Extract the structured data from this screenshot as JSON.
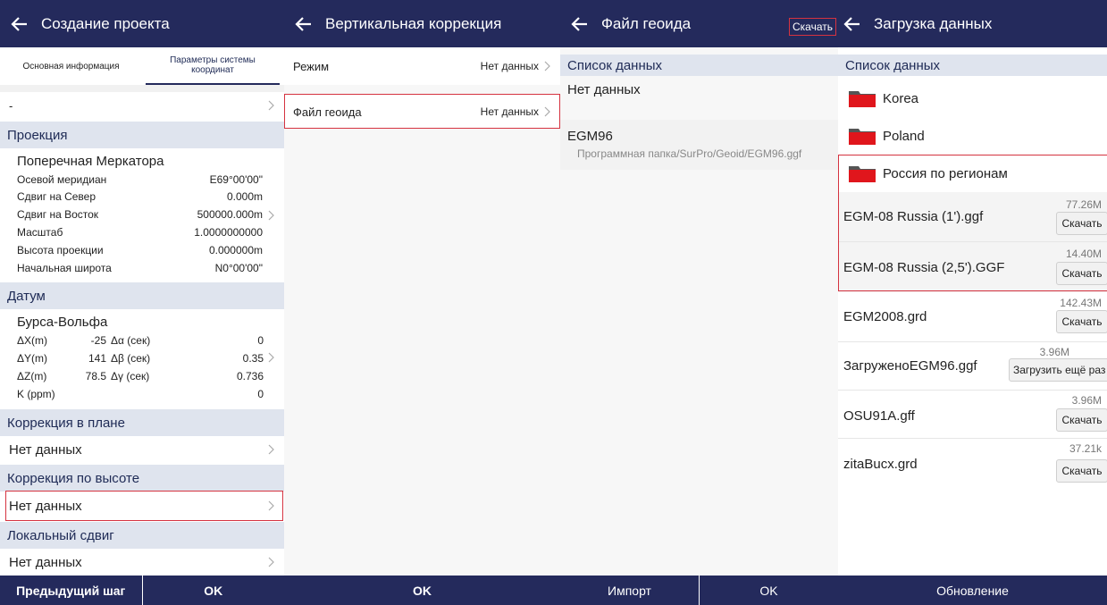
{
  "screen1": {
    "title": "Создание проекта",
    "tabs": [
      {
        "label": "Основная информация"
      },
      {
        "label": "Параметры системы координат"
      }
    ],
    "dash": "-",
    "projection": {
      "header": "Проекция",
      "name": "Поперечная Меркатора",
      "params": [
        {
          "label": "Осевой меридиан",
          "value": "E69°00'00\""
        },
        {
          "label": "Сдвиг на Север",
          "value": "0.000m"
        },
        {
          "label": "Сдвиг на Восток",
          "value": "500000.000m"
        },
        {
          "label": "Масштаб",
          "value": "1.0000000000"
        },
        {
          "label": "Высота проекции",
          "value": "0.000000m"
        },
        {
          "label": "Начальная широта",
          "value": "N0°00'00\""
        }
      ]
    },
    "datum": {
      "header": "Датум",
      "name": "Бурса-Вольфа",
      "rows": [
        {
          "l1": "ΔX(m)",
          "v1": "-25",
          "l2": "Δα (сек)",
          "v2": "0"
        },
        {
          "l1": "ΔY(m)",
          "v1": "141",
          "l2": "Δβ (сек)",
          "v2": "0.35"
        },
        {
          "l1": "ΔZ(m)",
          "v1": "78.5",
          "l2": "Δγ (сек)",
          "v2": "0.736"
        },
        {
          "l1": "K (ppm)",
          "v1": "",
          "l2": "",
          "v2": "0"
        }
      ]
    },
    "plane_correction": {
      "header": "Коррекция в плане",
      "value": "Нет данных"
    },
    "height_correction": {
      "header": "Коррекция по высоте",
      "value": "Нет данных"
    },
    "local_shift": {
      "header": "Локальный сдвиг",
      "value": "Нет данных"
    },
    "buttons": {
      "prev": "Предыдущий шаг",
      "ok": "OK"
    }
  },
  "screen2": {
    "title": "Вертикальная коррекция",
    "rows": [
      {
        "label": "Режим",
        "value": "Нет данных"
      },
      {
        "label": "Файл геоида",
        "value": "Нет данных"
      }
    ],
    "buttons": {
      "ok": "OK"
    }
  },
  "screen3": {
    "title": "Файл геоида",
    "download": "Скачать",
    "list_header": "Список данных",
    "no_data": "Нет данных",
    "item": {
      "name": "EGM96",
      "path": "Программная папка/SurPro/Geoid/EGM96.ggf"
    },
    "buttons": {
      "import": "Импорт",
      "ok": "OK"
    }
  },
  "screen4": {
    "title": "Загрузка данных",
    "list_header": "Список данных",
    "folders": [
      {
        "name": "Korea"
      },
      {
        "name": "Poland"
      },
      {
        "name": "Россия по регионам"
      }
    ],
    "files": [
      {
        "name": "EGM-08 Russia (1').ggf",
        "size": "77.26M",
        "action": "Скачать"
      },
      {
        "name": "EGM-08 Russia (2,5').GGF",
        "size": "14.40M",
        "action": "Скачать"
      },
      {
        "name": "EGM2008.grd",
        "size": "142.43M",
        "action": "Скачать"
      },
      {
        "name": "ЗагруженоEGM96.ggf",
        "size": "3.96M",
        "action": "Загрузить ещё раз"
      },
      {
        "name": "OSU91A.gff",
        "size": "3.96M",
        "action": "Скачать"
      },
      {
        "name": "zitaBucx.grd",
        "size": "37.21k",
        "action": "Скачать"
      }
    ],
    "buttons": {
      "update": "Обновление"
    }
  },
  "colors": {
    "bar": "#242a5c",
    "section": "#dfe4ee",
    "highlight": "#d53340",
    "folder": "#e0161c"
  },
  "icons": [
    "back-arrow-icon",
    "chevron-right-icon",
    "folder-icon"
  ]
}
